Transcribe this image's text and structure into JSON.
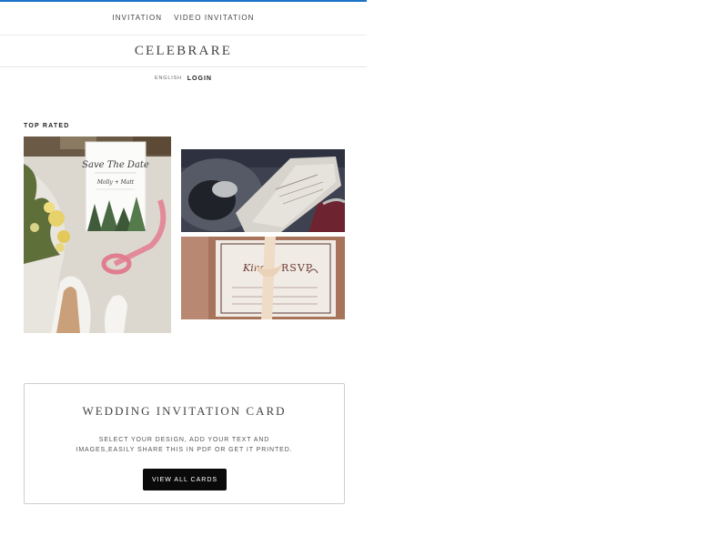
{
  "nav": {
    "items": [
      {
        "label": "INVITATION"
      },
      {
        "label": "VIDEO INVITATION"
      }
    ]
  },
  "header": {
    "brand": "CELEBRARE"
  },
  "subnav": {
    "language": "ENGLISH",
    "login": "LOGIN"
  },
  "section": {
    "label": "TOP RATED"
  },
  "images": {
    "left": {
      "card_script_1": "Save The Date",
      "card_script_2": "Molly + Matt"
    },
    "bottom_right": {
      "script": "Kind",
      "title": "RSVP"
    }
  },
  "card": {
    "title": "WEDDING INVITATION CARD",
    "description_line1": "SELECT YOUR DESIGN, ADD YOUR TEXT AND",
    "description_line2": "IMAGES,EASILY SHARE THIS IN PDF OR GET IT PRINTED.",
    "button": "VIEW ALL CARDS"
  },
  "colors": {
    "accent_topline": "#1a73c8",
    "button_bg": "#0a0a0a"
  }
}
